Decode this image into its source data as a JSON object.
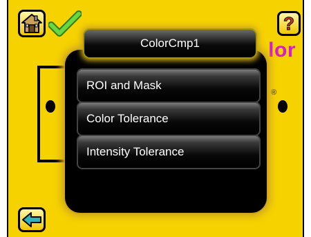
{
  "header": {
    "background_title": "lor",
    "background_reg_mark": "®"
  },
  "popup": {
    "title": "ColorCmp1",
    "items": [
      {
        "label": "ROI and Mask"
      },
      {
        "label": "Color Tolerance"
      },
      {
        "label": "Intensity Tolerance"
      }
    ]
  },
  "icons": {
    "home": "home-icon",
    "status": "checkmark-icon",
    "help": "help-question-icon",
    "back": "back-arrow-icon"
  },
  "colors": {
    "background": "#f6d200",
    "menu_background": "#000000",
    "menu_glow": "#d2aa1e",
    "title_accent": "#d61bd1",
    "check": "#5cc838"
  }
}
